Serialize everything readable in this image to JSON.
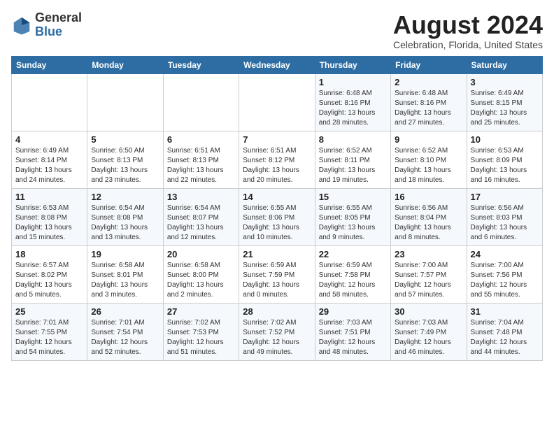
{
  "header": {
    "logo_general": "General",
    "logo_blue": "Blue",
    "month_year": "August 2024",
    "location": "Celebration, Florida, United States"
  },
  "weekdays": [
    "Sunday",
    "Monday",
    "Tuesday",
    "Wednesday",
    "Thursday",
    "Friday",
    "Saturday"
  ],
  "weeks": [
    [
      {
        "day": "",
        "sunrise": "",
        "sunset": "",
        "daylight": ""
      },
      {
        "day": "",
        "sunrise": "",
        "sunset": "",
        "daylight": ""
      },
      {
        "day": "",
        "sunrise": "",
        "sunset": "",
        "daylight": ""
      },
      {
        "day": "",
        "sunrise": "",
        "sunset": "",
        "daylight": ""
      },
      {
        "day": "1",
        "sunrise": "Sunrise: 6:48 AM",
        "sunset": "Sunset: 8:16 PM",
        "daylight": "Daylight: 13 hours and 28 minutes."
      },
      {
        "day": "2",
        "sunrise": "Sunrise: 6:48 AM",
        "sunset": "Sunset: 8:16 PM",
        "daylight": "Daylight: 13 hours and 27 minutes."
      },
      {
        "day": "3",
        "sunrise": "Sunrise: 6:49 AM",
        "sunset": "Sunset: 8:15 PM",
        "daylight": "Daylight: 13 hours and 25 minutes."
      }
    ],
    [
      {
        "day": "4",
        "sunrise": "Sunrise: 6:49 AM",
        "sunset": "Sunset: 8:14 PM",
        "daylight": "Daylight: 13 hours and 24 minutes."
      },
      {
        "day": "5",
        "sunrise": "Sunrise: 6:50 AM",
        "sunset": "Sunset: 8:13 PM",
        "daylight": "Daylight: 13 hours and 23 minutes."
      },
      {
        "day": "6",
        "sunrise": "Sunrise: 6:51 AM",
        "sunset": "Sunset: 8:13 PM",
        "daylight": "Daylight: 13 hours and 22 minutes."
      },
      {
        "day": "7",
        "sunrise": "Sunrise: 6:51 AM",
        "sunset": "Sunset: 8:12 PM",
        "daylight": "Daylight: 13 hours and 20 minutes."
      },
      {
        "day": "8",
        "sunrise": "Sunrise: 6:52 AM",
        "sunset": "Sunset: 8:11 PM",
        "daylight": "Daylight: 13 hours and 19 minutes."
      },
      {
        "day": "9",
        "sunrise": "Sunrise: 6:52 AM",
        "sunset": "Sunset: 8:10 PM",
        "daylight": "Daylight: 13 hours and 18 minutes."
      },
      {
        "day": "10",
        "sunrise": "Sunrise: 6:53 AM",
        "sunset": "Sunset: 8:09 PM",
        "daylight": "Daylight: 13 hours and 16 minutes."
      }
    ],
    [
      {
        "day": "11",
        "sunrise": "Sunrise: 6:53 AM",
        "sunset": "Sunset: 8:08 PM",
        "daylight": "Daylight: 13 hours and 15 minutes."
      },
      {
        "day": "12",
        "sunrise": "Sunrise: 6:54 AM",
        "sunset": "Sunset: 8:08 PM",
        "daylight": "Daylight: 13 hours and 13 minutes."
      },
      {
        "day": "13",
        "sunrise": "Sunrise: 6:54 AM",
        "sunset": "Sunset: 8:07 PM",
        "daylight": "Daylight: 13 hours and 12 minutes."
      },
      {
        "day": "14",
        "sunrise": "Sunrise: 6:55 AM",
        "sunset": "Sunset: 8:06 PM",
        "daylight": "Daylight: 13 hours and 10 minutes."
      },
      {
        "day": "15",
        "sunrise": "Sunrise: 6:55 AM",
        "sunset": "Sunset: 8:05 PM",
        "daylight": "Daylight: 13 hours and 9 minutes."
      },
      {
        "day": "16",
        "sunrise": "Sunrise: 6:56 AM",
        "sunset": "Sunset: 8:04 PM",
        "daylight": "Daylight: 13 hours and 8 minutes."
      },
      {
        "day": "17",
        "sunrise": "Sunrise: 6:56 AM",
        "sunset": "Sunset: 8:03 PM",
        "daylight": "Daylight: 13 hours and 6 minutes."
      }
    ],
    [
      {
        "day": "18",
        "sunrise": "Sunrise: 6:57 AM",
        "sunset": "Sunset: 8:02 PM",
        "daylight": "Daylight: 13 hours and 5 minutes."
      },
      {
        "day": "19",
        "sunrise": "Sunrise: 6:58 AM",
        "sunset": "Sunset: 8:01 PM",
        "daylight": "Daylight: 13 hours and 3 minutes."
      },
      {
        "day": "20",
        "sunrise": "Sunrise: 6:58 AM",
        "sunset": "Sunset: 8:00 PM",
        "daylight": "Daylight: 13 hours and 2 minutes."
      },
      {
        "day": "21",
        "sunrise": "Sunrise: 6:59 AM",
        "sunset": "Sunset: 7:59 PM",
        "daylight": "Daylight: 13 hours and 0 minutes."
      },
      {
        "day": "22",
        "sunrise": "Sunrise: 6:59 AM",
        "sunset": "Sunset: 7:58 PM",
        "daylight": "Daylight: 12 hours and 58 minutes."
      },
      {
        "day": "23",
        "sunrise": "Sunrise: 7:00 AM",
        "sunset": "Sunset: 7:57 PM",
        "daylight": "Daylight: 12 hours and 57 minutes."
      },
      {
        "day": "24",
        "sunrise": "Sunrise: 7:00 AM",
        "sunset": "Sunset: 7:56 PM",
        "daylight": "Daylight: 12 hours and 55 minutes."
      }
    ],
    [
      {
        "day": "25",
        "sunrise": "Sunrise: 7:01 AM",
        "sunset": "Sunset: 7:55 PM",
        "daylight": "Daylight: 12 hours and 54 minutes."
      },
      {
        "day": "26",
        "sunrise": "Sunrise: 7:01 AM",
        "sunset": "Sunset: 7:54 PM",
        "daylight": "Daylight: 12 hours and 52 minutes."
      },
      {
        "day": "27",
        "sunrise": "Sunrise: 7:02 AM",
        "sunset": "Sunset: 7:53 PM",
        "daylight": "Daylight: 12 hours and 51 minutes."
      },
      {
        "day": "28",
        "sunrise": "Sunrise: 7:02 AM",
        "sunset": "Sunset: 7:52 PM",
        "daylight": "Daylight: 12 hours and 49 minutes."
      },
      {
        "day": "29",
        "sunrise": "Sunrise: 7:03 AM",
        "sunset": "Sunset: 7:51 PM",
        "daylight": "Daylight: 12 hours and 48 minutes."
      },
      {
        "day": "30",
        "sunrise": "Sunrise: 7:03 AM",
        "sunset": "Sunset: 7:49 PM",
        "daylight": "Daylight: 12 hours and 46 minutes."
      },
      {
        "day": "31",
        "sunrise": "Sunrise: 7:04 AM",
        "sunset": "Sunset: 7:48 PM",
        "daylight": "Daylight: 12 hours and 44 minutes."
      }
    ]
  ]
}
